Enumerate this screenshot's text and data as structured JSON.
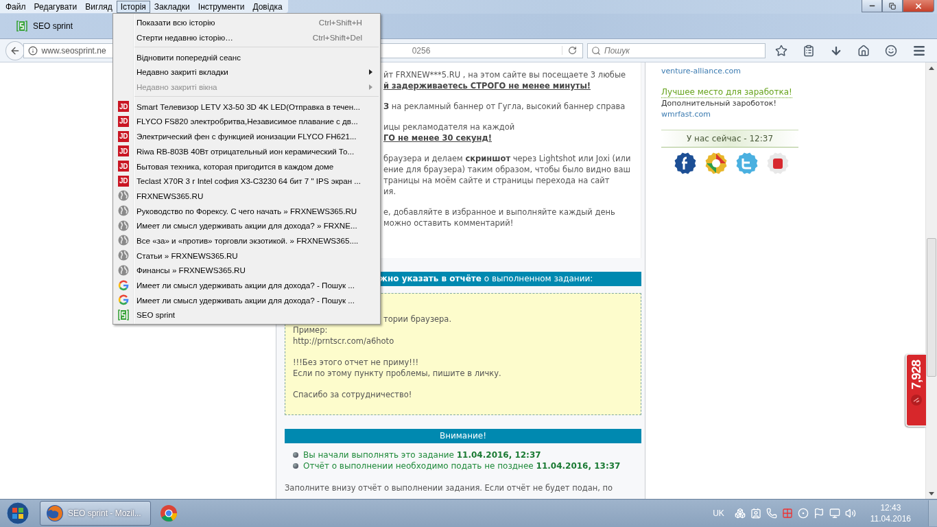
{
  "menu_bar": [
    {
      "label": "Файл",
      "selected": false
    },
    {
      "label": "Редагувати",
      "selected": false
    },
    {
      "label": "Вигляд",
      "selected": false
    },
    {
      "label": "Історія",
      "selected": true
    },
    {
      "label": "Закладки",
      "selected": false
    },
    {
      "label": "Інструменти",
      "selected": false
    },
    {
      "label": "Довідка",
      "selected": false
    }
  ],
  "tabs": [
    {
      "label": "SEO sprint",
      "selected": true
    }
  ],
  "address_bar": {
    "url_start": "www.seosprint.ne",
    "url_end": "0256"
  },
  "search": {
    "placeholder": "Пошук"
  },
  "history_menu": {
    "groups": [
      [
        {
          "kind": "command",
          "label": "Показати всю історію",
          "shortcut": "Ctrl+Shift+H",
          "disabled": false
        },
        {
          "kind": "command",
          "label": "Стерти недавню історію…",
          "shortcut": "Ctrl+Shift+Del",
          "disabled": false
        }
      ],
      [
        {
          "kind": "command",
          "label": "Відновити попередній сеанс",
          "disabled": false
        },
        {
          "kind": "submenu",
          "label": "Недавно закриті вкладки",
          "disabled": false
        },
        {
          "kind": "submenu",
          "label": "Недавно закриті вікна",
          "disabled": true
        }
      ],
      [
        {
          "kind": "shop_page",
          "badge": "JD",
          "label": "Smart Телевизор LETV X3-50 3D 4K LED(Отправка в течен...",
          "disabled": false
        },
        {
          "kind": "shop_page",
          "badge": "JD",
          "label": "FLYCO FS820 электробритва,Независимое плавание с дв...",
          "disabled": false
        },
        {
          "kind": "shop_page",
          "badge": "JD",
          "label": "Электрический фен с функцией ионизации FLYCO FH621...",
          "disabled": false
        },
        {
          "kind": "shop_page",
          "badge": "JD",
          "label": "Riwa RB-803B 40Вт отрицательный ион керамический То...",
          "disabled": false
        },
        {
          "kind": "shop_page",
          "badge": "JD",
          "label": "Бытовая техника, которая пригодится в каждом доме",
          "disabled": false
        },
        {
          "kind": "shop_page",
          "badge": "JD",
          "label": "Teclast X70R 3 г Intel софия X3-C3230 64 бит 7 \" IPS экран ...",
          "disabled": false
        },
        {
          "kind": "web_page",
          "label": "FRXNEWS365.RU",
          "disabled": false
        },
        {
          "kind": "web_page",
          "label": "Руководство по Форексу. С чего начать » FRXNEWS365.RU",
          "disabled": false
        },
        {
          "kind": "web_page",
          "label": "Имеет ли смысл удерживать акции для дохода? » FRXNE...",
          "disabled": false
        },
        {
          "kind": "web_page",
          "label": "Все «за» и «против» торговли экзотикой. » FRXNEWS365....",
          "disabled": false
        },
        {
          "kind": "web_page",
          "label": "Статьи » FRXNEWS365.RU",
          "disabled": false
        },
        {
          "kind": "web_page",
          "label": "Финансы » FRXNEWS365.RU",
          "disabled": false
        },
        {
          "kind": "search_page",
          "label": "Имеет ли смысл удерживать акции для дохода? - Пошук ...",
          "disabled": false
        },
        {
          "kind": "search_page",
          "label": "Имеет ли смысл удерживать акции для дохода? - Пошук ...",
          "disabled": false
        },
        {
          "kind": "site_page",
          "label": "SEO sprint",
          "disabled": false
        }
      ]
    ]
  },
  "task": {
    "paragraphs": [
      [
        {
          "kind": "plain",
          "text": "йт FRXNEW***5.RU , на этом сайте вы посещаете 3 любые"
        },
        {
          "kind": "strong",
          "text": "й задерживаетесь СТРОГО не менее минуты!"
        }
      ],
      [
        {
          "kind": "plain",
          "text": "**З** на рекламный баннер от Гугла, высокий баннер справа"
        }
      ],
      [
        {
          "kind": "plain",
          "text": "ицы рекламодателя на каждой"
        },
        {
          "kind": "strong",
          "text": "ГО не менее 30 секунд!"
        }
      ],
      [
        {
          "kind": "plain",
          "text": "браузера и делаем **скриншот** через Lightshot или Joxi (или"
        },
        {
          "kind": "plain",
          "text": "ение для браузера) таким образом, чтобы было видно ваш"
        },
        {
          "kind": "plain",
          "text": "траницы на моём сайте и страницы перехода на сайт"
        },
        {
          "kind": "plain",
          "text": "ия."
        }
      ],
      [
        {
          "kind": "plain",
          "text": "е, добавляйте в избранное и выполняйте каждый день"
        },
        {
          "kind": "plain",
          "text": "можно оставить комментарий!"
        }
      ]
    ]
  },
  "report_header": "**жно указать в отчёте** о выполненном задании:",
  "report_box": {
    "paragraphs": [
      [
        {
          "kind": "covered",
          "text": "тории браузера."
        },
        {
          "kind": "full",
          "text": "Пример:"
        },
        {
          "kind": "full",
          "text": "http://prntscr.com/a6hoto"
        }
      ],
      [
        {
          "kind": "full",
          "text": "!!!Без этого отчет не приму!!!"
        },
        {
          "kind": "full",
          "text": "Если по этому пункту проблемы, пишите в личку."
        }
      ],
      [
        {
          "kind": "full",
          "text": "Спасибо за сотрудничество!"
        }
      ]
    ]
  },
  "notice": {
    "title": "Внимание!",
    "items": [
      "Вы начали выполнять это задание **11.04.2016, 12:37**",
      "Отчёт о выполнении необходимо подать не позднее **11.04.2016, 13:37**"
    ]
  },
  "footer_text": "Заполните внизу отчёт о выполнении задания. Если отчёт не будет подан, по",
  "sidebar": {
    "entries": [
      {
        "kind": "link",
        "text": "venture-alliance.com"
      },
      {
        "kind": "headline",
        "text": "Лучшее место для заработка!"
      },
      {
        "kind": "note",
        "text": "Дополнительный зароботок!"
      },
      {
        "kind": "link",
        "text": "wmrfast.com"
      }
    ],
    "clock": "У нас сейчас - 12:37",
    "social": [
      {
        "kind": "facebook"
      },
      {
        "kind": "google"
      },
      {
        "kind": "twitter"
      },
      {
        "kind": "youtube"
      }
    ]
  },
  "counter": {
    "value": "7,928"
  },
  "taskbar": {
    "buttons": [
      {
        "kind": "firefox",
        "label": "SEO sprint - Mozil...",
        "selected": true
      },
      {
        "kind": "chrome",
        "selected": false
      }
    ],
    "language": "UK",
    "time": "12:43",
    "date": "11.04.2016"
  }
}
